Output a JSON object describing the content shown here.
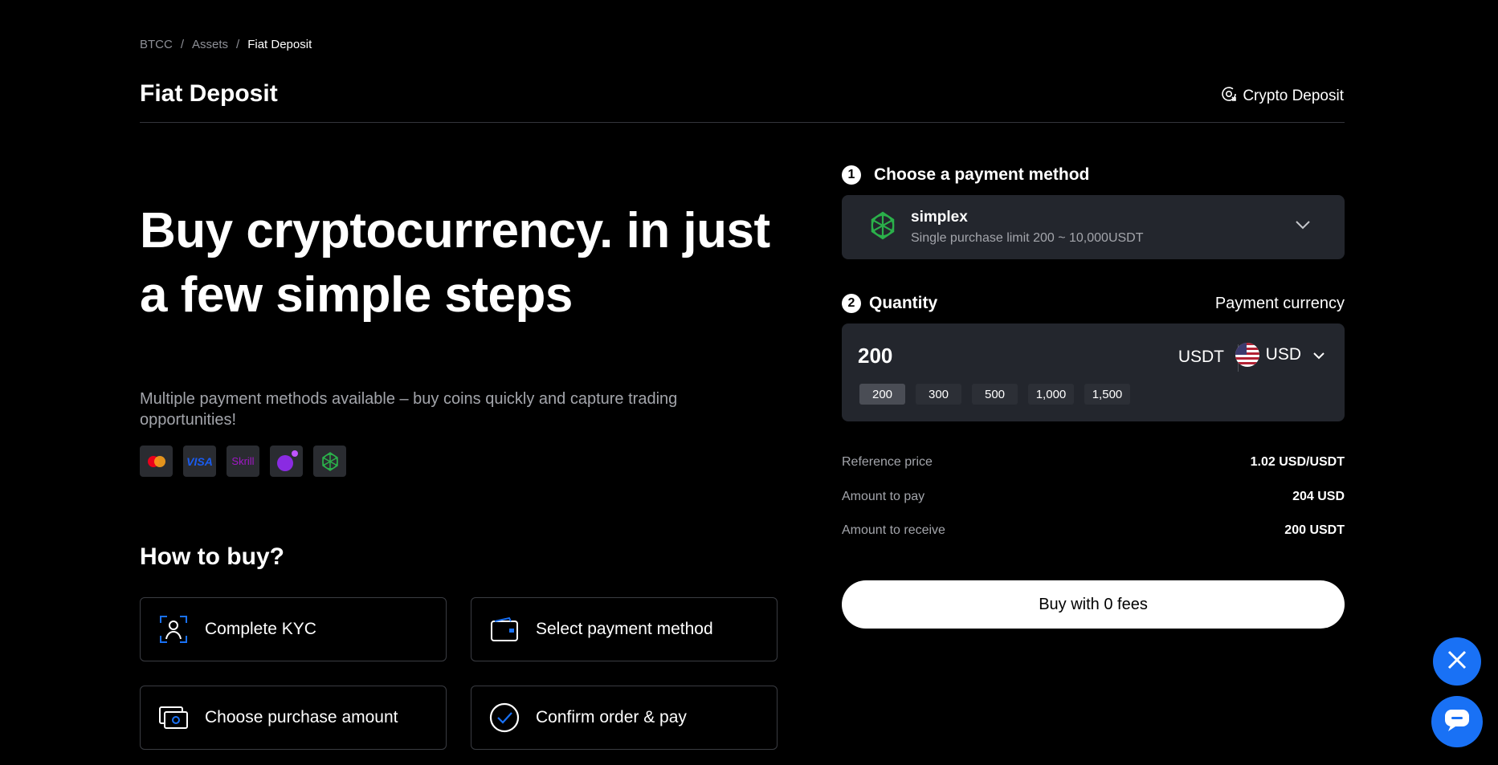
{
  "breadcrumb": {
    "root": "BTCC",
    "sep1": "/",
    "parent": "Assets",
    "sep2": "/",
    "current": "Fiat Deposit"
  },
  "header": {
    "title": "Fiat Deposit",
    "crypto_link": "Crypto Deposit"
  },
  "hero": {
    "line1": "Buy cryptocurrency. in just",
    "line2": "a few simple steps"
  },
  "subtitle": "Multiple payment methods available – buy coins quickly and capture trading opportunities!",
  "payment_icons": [
    "mastercard-icon",
    "visa-icon",
    "skrill-icon",
    "other-wallet-icon",
    "simplex-icon"
  ],
  "payment_text": {
    "visa": "VISA",
    "skrill": "Skrill"
  },
  "how_to_buy": {
    "title": "How to buy?",
    "steps": [
      {
        "label": "Complete KYC",
        "icon": "kyc-user-icon"
      },
      {
        "label": "Select payment method",
        "icon": "wallet-icon"
      },
      {
        "label": "Choose purchase amount",
        "icon": "cash-icon"
      },
      {
        "label": "Confirm order & pay",
        "icon": "check-circle-icon"
      }
    ]
  },
  "step1": {
    "number": "1",
    "title": "Choose a payment method",
    "method_name": "simplex",
    "method_desc": "Single purchase limit 200 ~ 10,000USDT"
  },
  "step2": {
    "number": "2",
    "title": "Quantity",
    "payment_currency_label": "Payment currency",
    "amount": "200",
    "unit": "USDT",
    "currency": "USD",
    "presets": [
      "200",
      "300",
      "500",
      "1,000",
      "1,500"
    ],
    "active_preset": "200"
  },
  "summary": [
    {
      "label": "Reference price",
      "value": "1.02 USD/USDT"
    },
    {
      "label": "Amount to pay",
      "value": "204 USD"
    },
    {
      "label": "Amount to receive",
      "value": "200 USDT"
    }
  ],
  "buy_button": "Buy with 0 fees",
  "colors": {
    "accent": "#1971f5",
    "panel": "#23262d",
    "muted": "#a3a5ab"
  }
}
